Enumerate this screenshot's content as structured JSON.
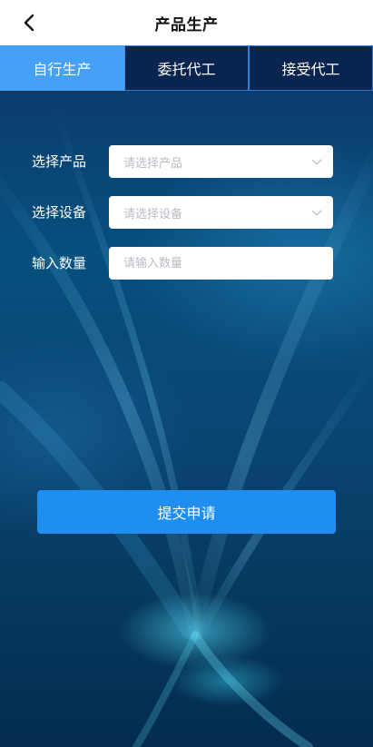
{
  "header": {
    "title": "产品生产",
    "back_icon": "chevron-left-icon"
  },
  "tabs": [
    {
      "label": "自行生产",
      "active": true
    },
    {
      "label": "委托代工",
      "active": false
    },
    {
      "label": "接受代工",
      "active": false
    }
  ],
  "form": {
    "product": {
      "label": "选择产品",
      "placeholder": "请选择产品",
      "icon": "chevron-down-icon"
    },
    "device": {
      "label": "选择设备",
      "placeholder": "请选择设备",
      "icon": "chevron-down-icon"
    },
    "quantity": {
      "label": "输入数量",
      "placeholder": "请输入数量",
      "value": ""
    }
  },
  "submit_label": "提交申请",
  "colors": {
    "active_tab": "#46a0f5",
    "tab_background": "#0a2450",
    "submit_button": "#1e8ff0",
    "background_dark": "#06507e"
  }
}
